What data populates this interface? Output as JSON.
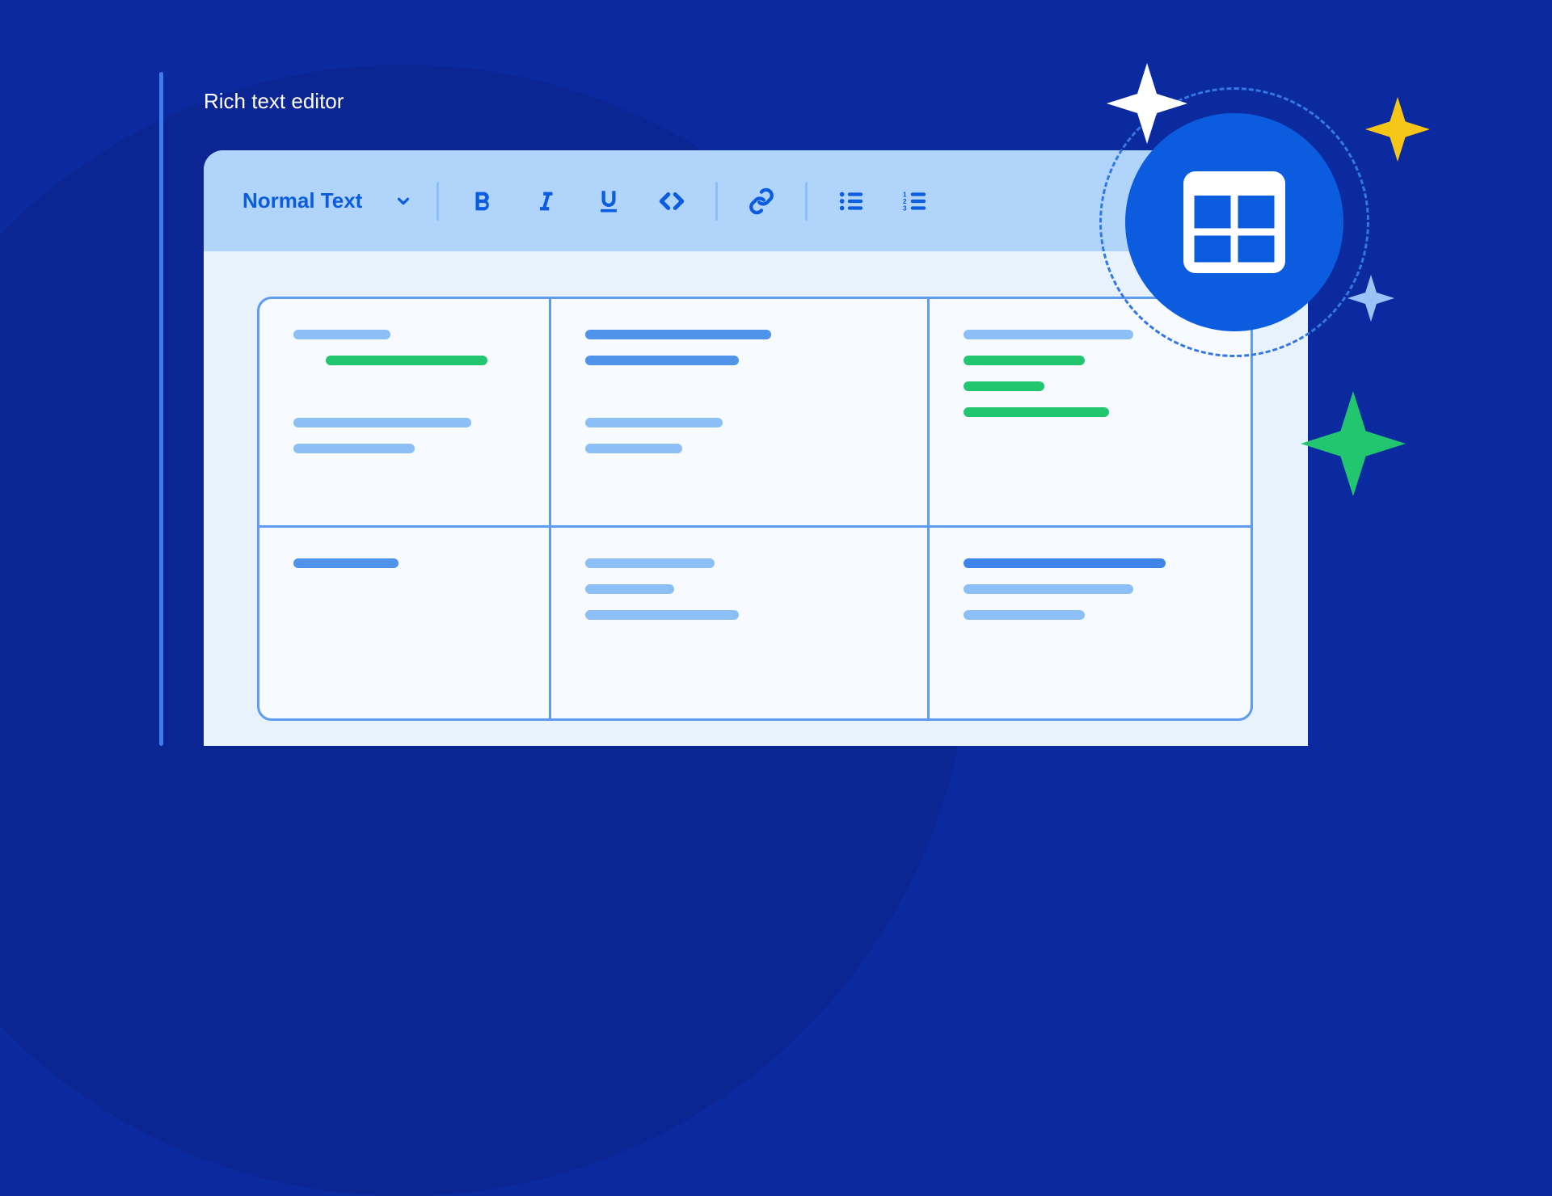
{
  "title": "Rich text editor",
  "toolbar": {
    "text_style": "Normal Text",
    "buttons": {
      "bold": "B",
      "italic": "I",
      "underline": "U",
      "code": "code",
      "link": "link",
      "bullet_list": "bullet-list",
      "numbered_list": "numbered-list"
    }
  },
  "badge": {
    "icon": "table-icon"
  },
  "colors": {
    "accent": "#0B5CDF",
    "green": "#22C66F",
    "blue_light": "#8CBFF6"
  }
}
